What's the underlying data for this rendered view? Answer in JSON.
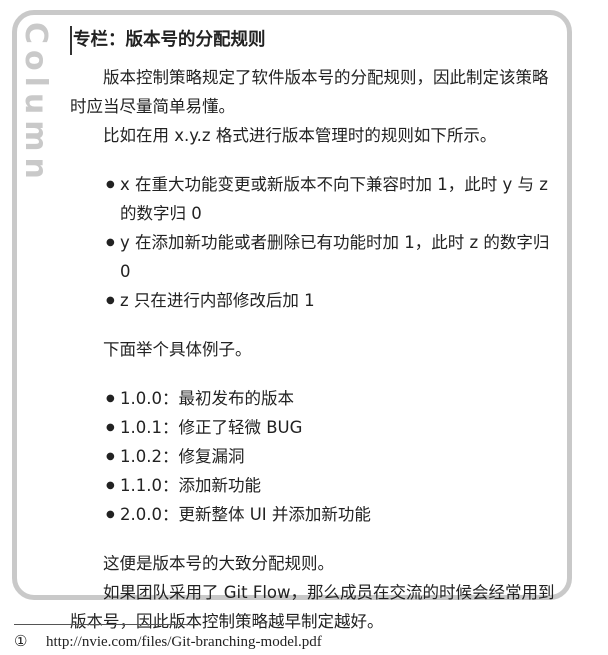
{
  "sidebar": {
    "label": "Column"
  },
  "column": {
    "title": "专栏：版本号的分配规则",
    "p1": "版本控制策略规定了软件版本号的分配规则，因此制定该策略时应当尽量简单易懂。",
    "p2": "比如在用 x.y.z 格式进行版本管理时的规则如下所示。",
    "rules": [
      "x 在重大功能变更或新版本不向下兼容时加 1，此时 y 与 z 的数字归 0",
      "y 在添加新功能或者删除已有功能时加 1，此时 z 的数字归 0",
      "z 只在进行内部修改后加 1"
    ],
    "p3": "下面举个具体例子。",
    "examples": [
      "1.0.0：最初发布的版本",
      "1.0.1：修正了轻微 BUG",
      "1.0.2：修复漏洞",
      "1.1.0：添加新功能",
      "2.0.0：更新整体 UI 并添加新功能"
    ],
    "p4": "这便是版本号的大致分配规则。",
    "p5": "如果团队采用了 Git Flow，那么成员在交流的时候会经常用到版本号，因此版本控制策略越早制定越好。"
  },
  "footnote": {
    "mark": "①",
    "text": "http://nvie.com/files/Git-branching-model.pdf"
  }
}
